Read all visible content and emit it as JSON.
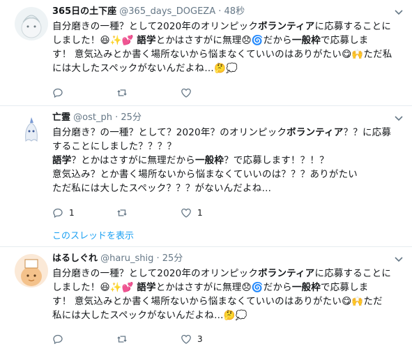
{
  "tweets": [
    {
      "name": "365日の土下座",
      "handle": "@365_days_DOGEZA",
      "dot": "·",
      "time": "48秒",
      "lines": [
        [
          "自分磨きの一種？として2020年のオリンピック",
          "ボランティア",
          "に応募することに"
        ],
        [
          "しました！😆✨💕 ",
          "語学",
          "とかはさすがに無理😞🌀だから",
          "一般枠",
          "で応募しま"
        ],
        [
          "す！ 意気込みとか書く場所ないから悩まなくていいのはありがたい😋🙌ただ私"
        ],
        [
          "には大したスペックがないんだよね…🤔💭"
        ]
      ],
      "reply_count": "",
      "retweet_count": "",
      "like_count": ""
    },
    {
      "name": "亡霊",
      "handle": "@ost_ph",
      "dot": "·",
      "time": "25分",
      "lines": [
        [
          "自分磨き？の一種？として？2020年？のオリンピック",
          "ボランティア",
          "？？に応募"
        ],
        [
          "することにしました？？？？"
        ],
        [
          "",
          "語学",
          "？とかはさすがに無理だから",
          "一般枠",
          "？で応募します！？！？"
        ],
        [
          "意気込み？とか書く場所ないから悩まなくていいのは？？？ありがたい"
        ],
        [
          "ただ私には大したスペック？？？がないんだよね…"
        ]
      ],
      "reply_count": "1",
      "retweet_count": "",
      "like_count": "1",
      "thread_link": "このスレッドを表示"
    },
    {
      "name": "はるしぐれ",
      "handle": "@haru_shig",
      "dot": "·",
      "time": "25分",
      "lines": [
        [
          "自分磨きの一種？として2020年のオリンピック",
          "ボランティア",
          "に応募することに"
        ],
        [
          "しました！😆✨💕 ",
          "語学",
          "とかはさすがに無理😞🌀だから",
          "一般枠",
          "で応募しま"
        ],
        [
          "す！ 意気込みとか書く場所ないから悩まなくていいのはありがたい😋🙌ただ"
        ],
        [
          "私には大したスペックがないんだよね…🤔💭"
        ]
      ],
      "reply_count": "",
      "retweet_count": "",
      "like_count": "3"
    }
  ],
  "colors": {
    "accent": "#1da1f2",
    "muted": "#657786",
    "text": "#14171a",
    "divider": "#e6ecf0"
  }
}
